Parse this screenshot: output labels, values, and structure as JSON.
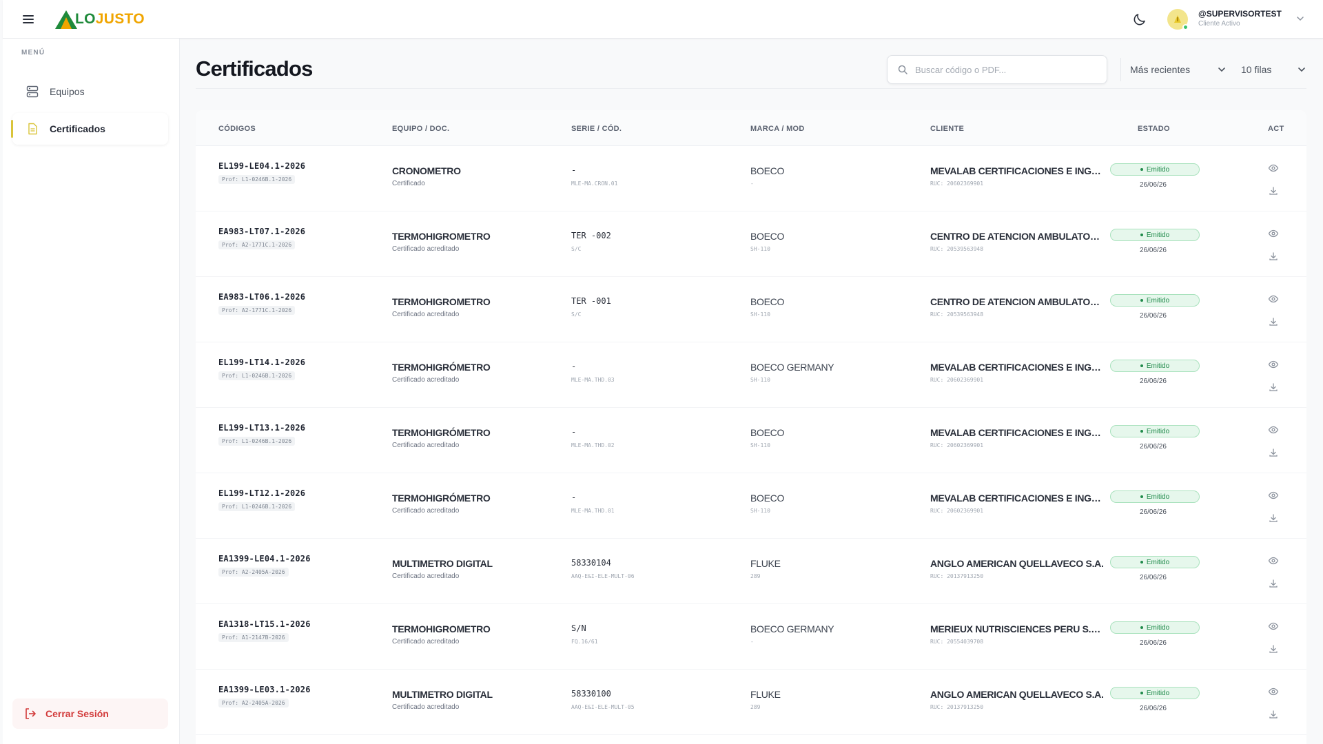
{
  "header": {
    "menu_icon": "hamburger-icon",
    "logo_lo": "LO",
    "logo_justo": "JUSTO",
    "theme_icon": "moon-icon",
    "user_name": "@SUPERVISORTEST",
    "user_role": "Cliente Activo",
    "colors": {
      "brand_green": "#1f8a3b",
      "brand_yellow": "#f0a500"
    }
  },
  "sidebar": {
    "menu_label": "MENÚ",
    "items": [
      {
        "label": "Equipos",
        "icon": "server-icon",
        "active": false
      },
      {
        "label": "Certificados",
        "icon": "document-icon",
        "active": true
      }
    ],
    "logout_label": "Cerrar Sesión"
  },
  "main": {
    "title": "Certificados",
    "search_placeholder": "Buscar código o PDF...",
    "sort_label": "Más recientes",
    "rows_label": "10 filas"
  },
  "table": {
    "columns": [
      "CÓDIGOS",
      "EQUIPO / DOC.",
      "SERIE / CÓD.",
      "MARCA / MOD",
      "CLIENTE",
      "ESTADO",
      "ACT"
    ],
    "rows": [
      {
        "code": "EL199-LE04.1-2026",
        "prof": "Prof: L1-0246B.1-2026",
        "equipo": "CRONOMETRO",
        "doc": "Certificado",
        "serie": "-",
        "cod": "MLE-MA.CRON.01",
        "marca": "BOECO",
        "modelo": "-",
        "cliente": "MEVALAB CERTIFICACIONES E INGENIERIA S.A.C.",
        "ruc": "RUC: 20602369901",
        "estado": "Emitido",
        "fecha": "26/06/26"
      },
      {
        "code": "EA983-LT07.1-2026",
        "prof": "Prof: A2-1771C.1-2026",
        "equipo": "TERMOHIGROMETRO",
        "doc": "Certificado acreditado",
        "serie": "TER -002",
        "cod": "S/C",
        "marca": "BOECO",
        "modelo": "SH-110",
        "cliente": "CENTRO DE ATENCION AMBULATORIO",
        "ruc": "RUC: 20539563948",
        "estado": "Emitido",
        "fecha": "26/06/26"
      },
      {
        "code": "EA983-LT06.1-2026",
        "prof": "Prof: A2-1771C.1-2026",
        "equipo": "TERMOHIGROMETRO",
        "doc": "Certificado acreditado",
        "serie": "TER -001",
        "cod": "S/C",
        "marca": "BOECO",
        "modelo": "SH-110",
        "cliente": "CENTRO DE ATENCION AMBULATORIO",
        "ruc": "RUC: 20539563948",
        "estado": "Emitido",
        "fecha": "26/06/26"
      },
      {
        "code": "EL199-LT14.1-2026",
        "prof": "Prof: L1-0246B.1-2026",
        "equipo": "TERMOHIGRÓMETRO",
        "doc": "Certificado acreditado",
        "serie": "-",
        "cod": "MLE-MA.THD.03",
        "marca": "BOECO GERMANY",
        "modelo": "SH-110",
        "cliente": "MEVALAB CERTIFICACIONES E INGENIERIA S.A.C.",
        "ruc": "RUC: 20602369901",
        "estado": "Emitido",
        "fecha": "26/06/26"
      },
      {
        "code": "EL199-LT13.1-2026",
        "prof": "Prof: L1-0246B.1-2026",
        "equipo": "TERMOHIGRÓMETRO",
        "doc": "Certificado acreditado",
        "serie": "-",
        "cod": "MLE-MA.THD.02",
        "marca": "BOECO",
        "modelo": "SH-110",
        "cliente": "MEVALAB CERTIFICACIONES E INGENIERIA S.A.C.",
        "ruc": "RUC: 20602369901",
        "estado": "Emitido",
        "fecha": "26/06/26"
      },
      {
        "code": "EL199-LT12.1-2026",
        "prof": "Prof: L1-0246B.1-2026",
        "equipo": "TERMOHIGRÓMETRO",
        "doc": "Certificado acreditado",
        "serie": "-",
        "cod": "MLE-MA.THD.01",
        "marca": "BOECO",
        "modelo": "SH-110",
        "cliente": "MEVALAB CERTIFICACIONES E INGENIERIA S.A.C.",
        "ruc": "RUC: 20602369901",
        "estado": "Emitido",
        "fecha": "26/06/26"
      },
      {
        "code": "EA1399-LE04.1-2026",
        "prof": "Prof: A2-2405A-2026",
        "equipo": "MULTIMETRO DIGITAL",
        "doc": "Certificado acreditado",
        "serie": "58330104",
        "cod": "AAQ-E&I-ELE-MULT-06",
        "marca": "FLUKE",
        "modelo": "289",
        "cliente": "ANGLO AMERICAN QUELLAVECO S.A.",
        "ruc": "RUC: 20137913250",
        "estado": "Emitido",
        "fecha": "26/06/26"
      },
      {
        "code": "EA1318-LT15.1-2026",
        "prof": "Prof: A1-2147B-2026",
        "equipo": "TERMOHIGROMETRO",
        "doc": "Certificado acreditado",
        "serie": "S/N",
        "cod": "FQ.16/61",
        "marca": "BOECO GERMANY",
        "modelo": "-",
        "cliente": "MERIEUX NUTRISCIENCES PERU S.A.C.",
        "ruc": "RUC: 20554039708",
        "estado": "Emitido",
        "fecha": "26/06/26"
      },
      {
        "code": "EA1399-LE03.1-2026",
        "prof": "Prof: A2-2405A-2026",
        "equipo": "MULTIMETRO DIGITAL",
        "doc": "Certificado acreditado",
        "serie": "58330100",
        "cod": "AAQ-E&I-ELE-MULT-05",
        "marca": "FLUKE",
        "modelo": "289",
        "cliente": "ANGLO AMERICAN QUELLAVECO S.A.",
        "ruc": "RUC: 20137913250",
        "estado": "Emitido",
        "fecha": "26/06/26"
      }
    ],
    "status_color": "#1f8a4a",
    "action_icons": [
      "eye-icon",
      "download-icon"
    ]
  }
}
